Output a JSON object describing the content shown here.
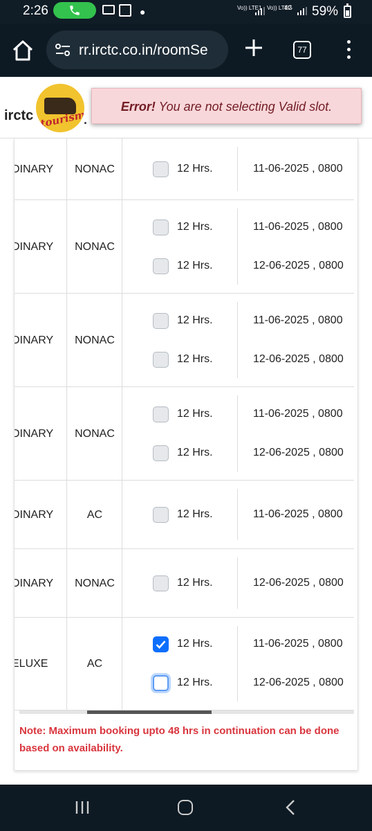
{
  "status_bar": {
    "time": "2:26",
    "sim1": "Vo)) LTE1",
    "sim2": "Vo)) LTE2",
    "network": "4G",
    "battery": "59%"
  },
  "browser": {
    "url": "rr.irctc.co.in/roomSe",
    "tab_count": "77"
  },
  "header": {
    "brand": "irctc",
    "logo_word": "tourism",
    "dot": "."
  },
  "error": {
    "bold": "Error!",
    "message": " You are not selecting Valid slot."
  },
  "slot_label": "12 Hrs.",
  "rows": [
    {
      "type": "DINARY",
      "ac": "NONAC",
      "slots": [
        {
          "label": "12 Hrs.",
          "date": "11-06-2025 , 0800",
          "checked": false
        }
      ]
    },
    {
      "type": "DINARY",
      "ac": "NONAC",
      "slots": [
        {
          "label": "12 Hrs.",
          "date": "11-06-2025 , 0800",
          "checked": false
        },
        {
          "label": "12 Hrs.",
          "date": "12-06-2025 , 0800",
          "checked": false
        }
      ]
    },
    {
      "type": "DINARY",
      "ac": "NONAC",
      "slots": [
        {
          "label": "12 Hrs.",
          "date": "11-06-2025 , 0800",
          "checked": false
        },
        {
          "label": "12 Hrs.",
          "date": "12-06-2025 , 0800",
          "checked": false
        }
      ]
    },
    {
      "type": "DINARY",
      "ac": "NONAC",
      "slots": [
        {
          "label": "12 Hrs.",
          "date": "11-06-2025 , 0800",
          "checked": false
        },
        {
          "label": "12 Hrs.",
          "date": "12-06-2025 , 0800",
          "checked": false
        }
      ]
    },
    {
      "type": "DINARY",
      "ac": "AC",
      "slots": [
        {
          "label": "12 Hrs.",
          "date": "11-06-2025 , 0800",
          "checked": false
        }
      ]
    },
    {
      "type": "DINARY",
      "ac": "NONAC",
      "slots": [
        {
          "label": "12 Hrs.",
          "date": "12-06-2025 , 0800",
          "checked": false
        }
      ]
    },
    {
      "type": "ELUXE",
      "ac": "AC",
      "slots": [
        {
          "label": "12 Hrs.",
          "date": "11-06-2025 , 0800",
          "checked": true
        },
        {
          "label": "12 Hrs.",
          "date": "12-06-2025 , 0800",
          "checked": false,
          "focused": true
        }
      ]
    }
  ],
  "note": "Note: Maximum booking upto 48 hrs in continuation can be done based on availability."
}
